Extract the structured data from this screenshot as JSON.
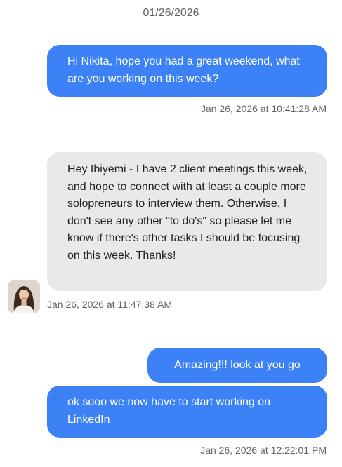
{
  "conversation": {
    "date_header": "01/26/2026",
    "messages": [
      {
        "direction": "outgoing",
        "text": "Hi Nikita, hope you had a great weekend, what are you working on this week?",
        "timestamp": "Jan 26, 2026 at 10:41:28 AM"
      },
      {
        "direction": "incoming",
        "text": "Hey Ibiyemi - I have 2 client meetings this week, and hope to connect with at least a couple more solopreneurs to interview them. Otherwise, I don't see any other \"to do's\" so please let me know if there's other tasks I should be focusing on this week. Thanks!",
        "timestamp": "Jan 26, 2026 at 11:47:38 AM",
        "avatar_icon": "user-photo-avatar"
      },
      {
        "direction": "outgoing",
        "text": "Amazing!!! look at you go"
      },
      {
        "direction": "outgoing",
        "text": "ok sooo we now have to start working on LinkedIn",
        "timestamp": "Jan 26, 2026 at 12:22:01 PM"
      }
    ]
  },
  "colors": {
    "outgoing_bubble": "#3c82f6",
    "incoming_bubble": "#e9e9eb",
    "timestamp_text": "#5f6368"
  }
}
